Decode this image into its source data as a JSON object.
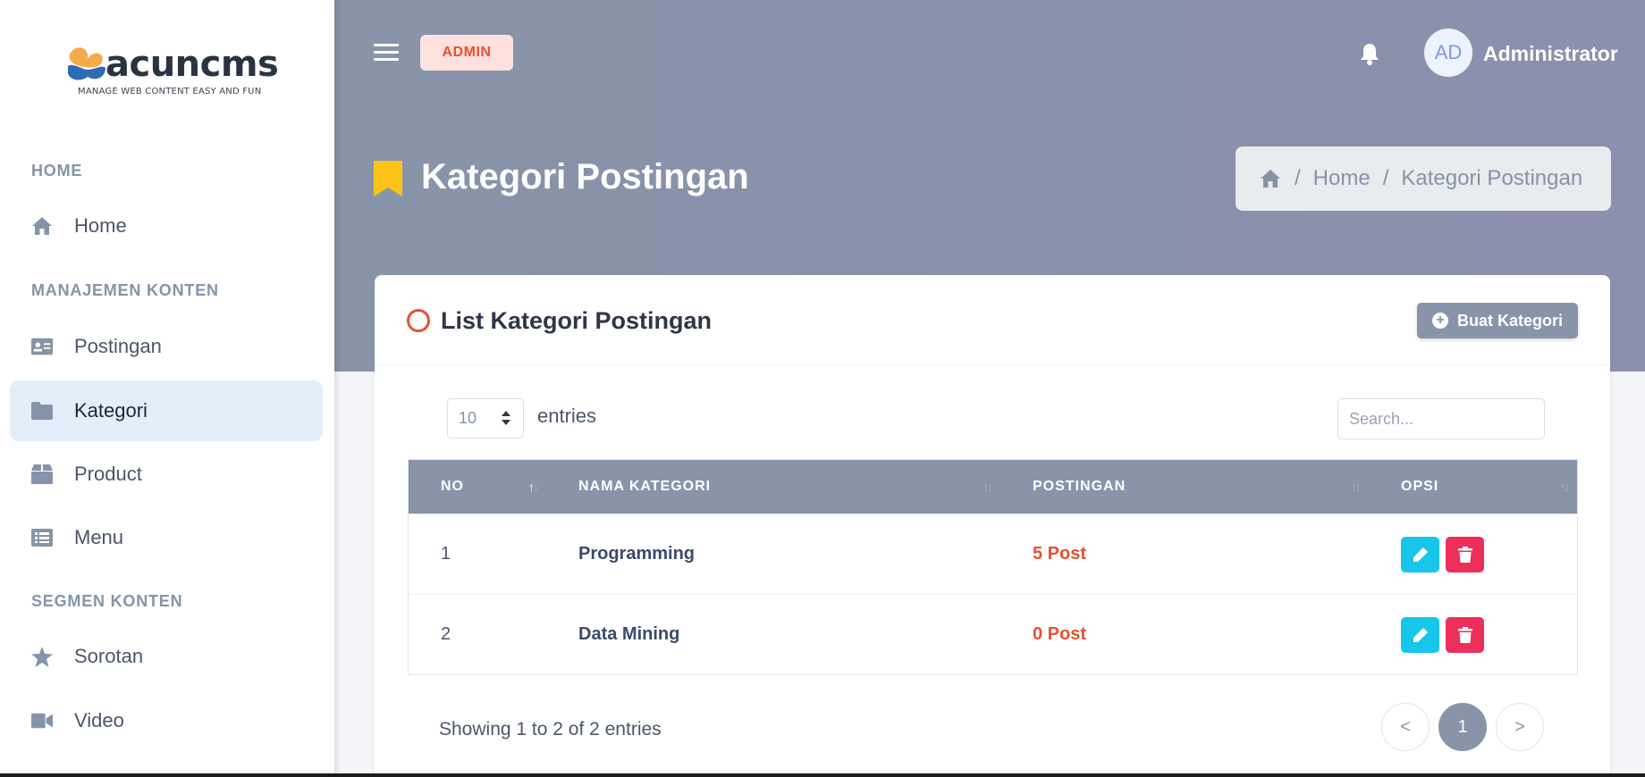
{
  "brand": {
    "name": "acuncms",
    "tagline": "MANAGE WEB CONTENT EASY AND FUN"
  },
  "sidebar": {
    "sections": [
      {
        "label": "HOME"
      },
      {
        "label": "MANAJEMEN KONTEN"
      },
      {
        "label": "SEGMEN KONTEN"
      }
    ],
    "items": [
      {
        "label": "Home",
        "icon": "home-icon"
      },
      {
        "label": "Postingan",
        "icon": "id-card-icon"
      },
      {
        "label": "Kategori",
        "icon": "folder-icon",
        "active": true
      },
      {
        "label": "Product",
        "icon": "box-icon"
      },
      {
        "label": "Menu",
        "icon": "list-icon"
      },
      {
        "label": "Sorotan",
        "icon": "star-icon"
      },
      {
        "label": "Video",
        "icon": "video-icon"
      }
    ]
  },
  "header": {
    "role_badge": "ADMIN",
    "avatar_initials": "AD",
    "user_name": "Administrator"
  },
  "page": {
    "title": "Kategori Postingan",
    "breadcrumb": [
      "Home",
      "Kategori Postingan"
    ]
  },
  "card": {
    "title": "List Kategori Postingan",
    "create_button": "Buat Kategori",
    "page_length": "10",
    "entries_label": "entries",
    "search_placeholder": "Search...",
    "columns": [
      "NO",
      "NAMA KATEGORI",
      "POSTINGAN",
      "OPSI"
    ],
    "rows": [
      {
        "no": "1",
        "name": "Programming",
        "posts": "5 Post"
      },
      {
        "no": "2",
        "name": "Data Mining",
        "posts": "0 Post"
      }
    ],
    "info": "Showing 1 to 2 of 2 entries",
    "pagination": {
      "prev": "<",
      "current": "1",
      "next": ">"
    }
  },
  "colors": {
    "accent": "#8794a9",
    "danger": "#ee2e5b",
    "info": "#17c6ea",
    "highlight": "#e8502f"
  }
}
